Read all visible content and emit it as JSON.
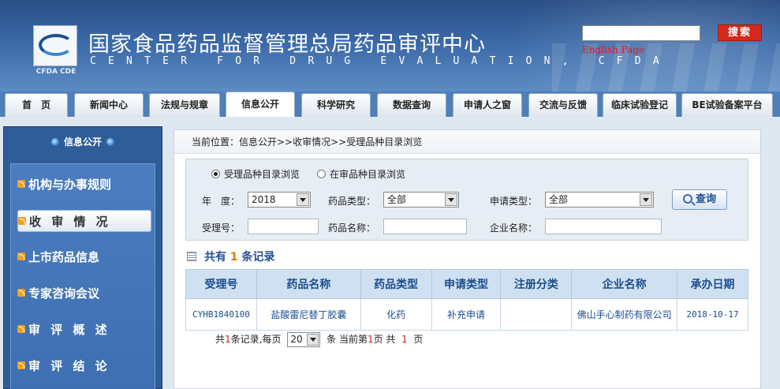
{
  "header": {
    "logo_caption": "CFDA CDE",
    "title": "国家食品药品监督管理总局药品审评中心",
    "subtitle": "CENTER FOR DRUG EVALUATION, CFDA",
    "search_placeholder": "",
    "search_button": "搜索",
    "english_link": "English Page"
  },
  "nav": {
    "items": [
      "首　页",
      "新闻中心",
      "法规与规章",
      "信息公开",
      "科学研究",
      "数据查询",
      "申请人之窗",
      "交流与反馈",
      "临床试验登记",
      "BE试验备案平台"
    ],
    "active_index": 3
  },
  "sidebar": {
    "header": "信息公开",
    "items": [
      "机构与办事规则",
      "收 审 情 况",
      "上市药品信息",
      "专家咨询会议",
      "审 评 概 述",
      "审 评 结 论"
    ],
    "active_index": 1
  },
  "main": {
    "breadcrumb": "当前位置：信息公开>>收审情况>>受理品种目录浏览",
    "radio_options": [
      {
        "label": "受理品种目录浏览",
        "checked": true
      },
      {
        "label": "在审品种目录浏览",
        "checked": false
      }
    ],
    "filters": {
      "year_label": "年　度：",
      "year_value": "2018",
      "drug_type_label": "药品类型：",
      "drug_type_value": "全部",
      "apply_type_label": "申请类型：",
      "apply_type_value": "全部",
      "accept_no_label": "受理号：",
      "accept_no_value": "",
      "drug_name_label": "药品名称：",
      "drug_name_value": "",
      "company_label": "企业名称：",
      "company_value": "",
      "query_button": "查询"
    },
    "records": {
      "prefix": "共有",
      "count": "1",
      "suffix": "条记录"
    },
    "table": {
      "columns": [
        "受理号",
        "药品名称",
        "药品类型",
        "申请类型",
        "注册分类",
        "企业名称",
        "承办日期"
      ],
      "rows": [
        [
          "CYHB1840100",
          "盐酸雷尼替丁胶囊",
          "化药",
          "补充申请",
          "",
          "佛山手心制药有限公司",
          "2018-10-17"
        ]
      ]
    },
    "pager": {
      "t1": "共",
      "total": "1",
      "t2": "条记录,每页",
      "per_page": "20",
      "t3": "条 当前第",
      "current": "1",
      "t4": "页 共",
      "pages": "1",
      "t5": "页"
    }
  }
}
